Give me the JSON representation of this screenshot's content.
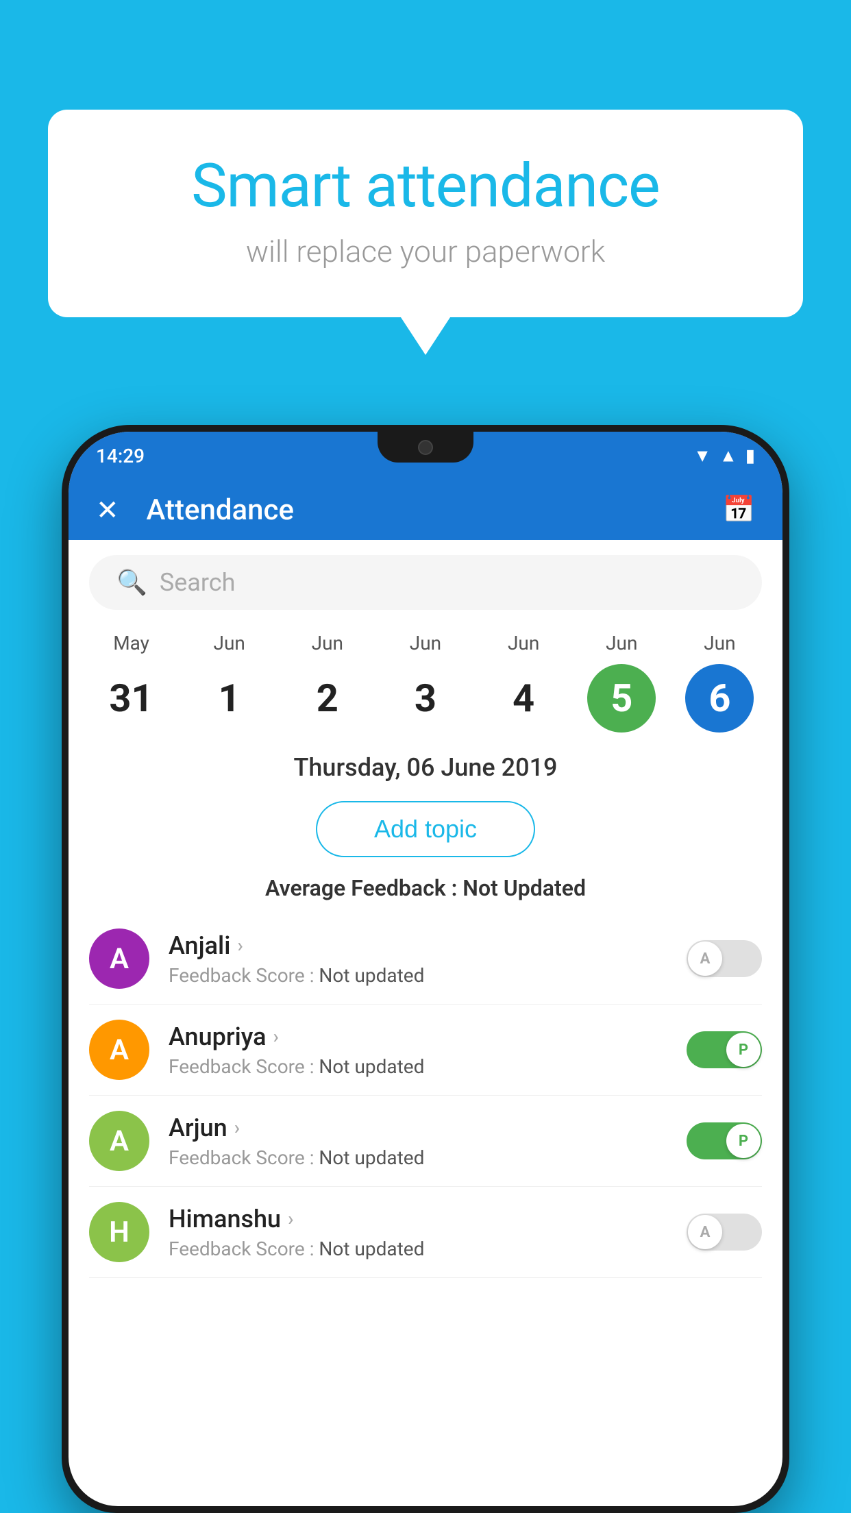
{
  "background_color": "#1ab8e8",
  "bubble": {
    "title": "Smart attendance",
    "subtitle": "will replace your paperwork"
  },
  "phone": {
    "status_bar": {
      "time": "14:29",
      "icons": [
        "wifi",
        "signal",
        "battery"
      ]
    },
    "header": {
      "title": "Attendance",
      "close_label": "✕",
      "calendar_icon": "📅"
    },
    "search": {
      "placeholder": "Search"
    },
    "calendar": {
      "days": [
        {
          "month": "May",
          "num": "31",
          "state": "normal"
        },
        {
          "month": "Jun",
          "num": "1",
          "state": "normal"
        },
        {
          "month": "Jun",
          "num": "2",
          "state": "normal"
        },
        {
          "month": "Jun",
          "num": "3",
          "state": "normal"
        },
        {
          "month": "Jun",
          "num": "4",
          "state": "normal"
        },
        {
          "month": "Jun",
          "num": "5",
          "state": "today"
        },
        {
          "month": "Jun",
          "num": "6",
          "state": "selected"
        }
      ]
    },
    "selected_date": "Thursday, 06 June 2019",
    "add_topic_label": "Add topic",
    "avg_feedback_label": "Average Feedback :",
    "avg_feedback_value": "Not Updated",
    "students": [
      {
        "name": "Anjali",
        "avatar_letter": "A",
        "avatar_color": "#9c27b0",
        "feedback": "Feedback Score :",
        "feedback_value": "Not updated",
        "toggle": "off",
        "toggle_label": "A"
      },
      {
        "name": "Anupriya",
        "avatar_letter": "A",
        "avatar_color": "#ff9800",
        "feedback": "Feedback Score :",
        "feedback_value": "Not updated",
        "toggle": "on",
        "toggle_label": "P"
      },
      {
        "name": "Arjun",
        "avatar_letter": "A",
        "avatar_color": "#8bc34a",
        "feedback": "Feedback Score :",
        "feedback_value": "Not updated",
        "toggle": "on",
        "toggle_label": "P"
      },
      {
        "name": "Himanshu",
        "avatar_letter": "H",
        "avatar_color": "#8bc34a",
        "feedback": "Feedback Score :",
        "feedback_value": "Not updated",
        "toggle": "off",
        "toggle_label": "A"
      }
    ]
  }
}
